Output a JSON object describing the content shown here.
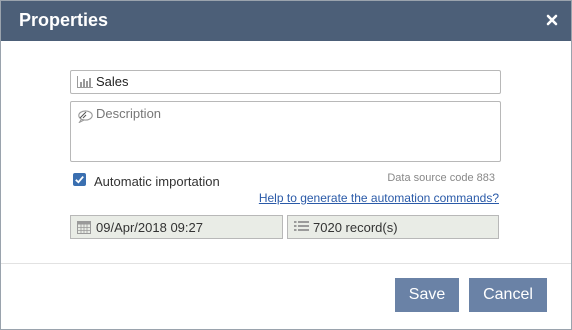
{
  "dialog": {
    "title": "Properties",
    "close_icon": "close-icon"
  },
  "name_field": {
    "icon": "bar-chart-icon",
    "value": "Sales"
  },
  "description_field": {
    "icon": "speech-bubble-icon",
    "placeholder": "Description",
    "value": ""
  },
  "automatic_importation": {
    "checked": true,
    "label": "Automatic importation"
  },
  "data_source_code": "Data source code 883",
  "help_link": "Help to generate the automation commands?",
  "date_field": {
    "icon": "calendar-icon",
    "value": "09/Apr/2018 09:27"
  },
  "records_field": {
    "icon": "list-icon",
    "value": "7020 record(s)"
  },
  "buttons": {
    "save": "Save",
    "cancel": "Cancel"
  },
  "colors": {
    "titlebar": "#4c5f78",
    "button": "#6a82a6",
    "checkbox": "#3a6fb0",
    "link": "#2a5aa8"
  }
}
